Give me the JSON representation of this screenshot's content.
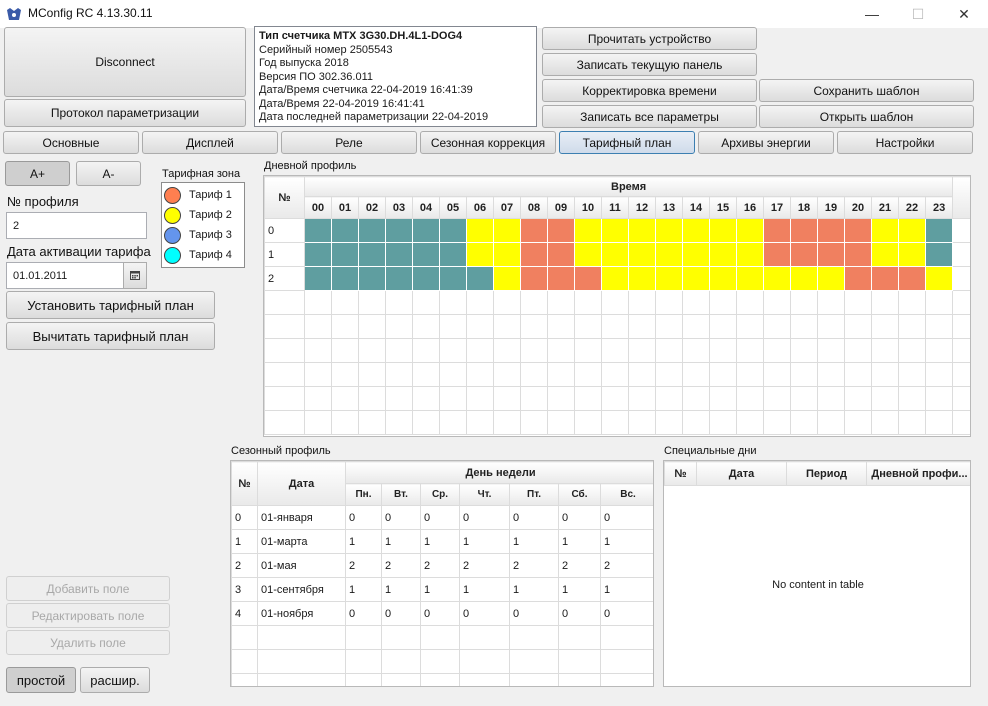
{
  "window": {
    "title": "MConfig RC 4.13.30.11",
    "min_glyph": "—",
    "max_glyph": "☐",
    "close_glyph": "✕"
  },
  "top": {
    "disconnect_label": "Disconnect",
    "protocol_label": "Протокол параметризации",
    "info_lines": [
      "Тип счетчика МТХ 3G30.DH.4L1-DOG4",
      "Серийный номер  2505543",
      "Год выпуска 2018",
      "Версия ПО 302.36.011",
      "Дата/Время счетчика  22-04-2019 16:41:39",
      "Дата/Время 22-04-2019 16:41:41",
      "Дата последней параметризации  22-04-2019"
    ],
    "read_device": "Прочитать устройство",
    "write_panel": "Записать текущую панель",
    "time_correction": "Корректировка времени",
    "write_all": "Записать все параметры",
    "save_template": "Сохранить шаблон",
    "open_template": "Открыть шаблон"
  },
  "tabs": [
    "Основные",
    "Дисплей",
    "Реле",
    "Сезонная коррекция",
    "Тарифный план",
    "Архивы энергии",
    "Настройки"
  ],
  "active_tab": 4,
  "left": {
    "font_plus": "A+",
    "font_minus": "A-",
    "profile_no_label": "№ профиля",
    "profile_no_value": "2",
    "activation_label": "Дата активации тарифа",
    "activation_value": "01.01.2011",
    "set_plan": "Установить тарифный план",
    "read_plan": "Вычитать тарифный план",
    "add_field": "Добавить поле",
    "edit_field": "Редактировать поле",
    "delete_field": "Удалить поле",
    "mode_simple": "простой",
    "mode_extended": "расшир."
  },
  "tariff_zone": {
    "title": "Тарифная зона",
    "items": [
      {
        "label": "Тариф 1",
        "color": "#ff7f50"
      },
      {
        "label": "Тариф 2",
        "color": "#ffff00"
      },
      {
        "label": "Тариф 3",
        "color": "#6495ed"
      },
      {
        "label": "Тариф 4",
        "color": "#00ffff"
      }
    ]
  },
  "daily_profile": {
    "title": "Дневной профиль",
    "num_header": "№",
    "time_header": "Время",
    "hours": [
      "00",
      "01",
      "02",
      "03",
      "04",
      "05",
      "06",
      "07",
      "08",
      "09",
      "10",
      "11",
      "12",
      "13",
      "14",
      "15",
      "16",
      "17",
      "18",
      "19",
      "20",
      "21",
      "22",
      "23"
    ],
    "cell_colors": {
      "1": "#f08060",
      "2": "#ffff00",
      "3": "#5f9ea0"
    },
    "rows": [
      {
        "num": "0",
        "tariffs": [
          3,
          3,
          3,
          3,
          3,
          3,
          2,
          2,
          1,
          1,
          2,
          2,
          2,
          2,
          2,
          2,
          2,
          1,
          1,
          1,
          1,
          2,
          2,
          3
        ]
      },
      {
        "num": "1",
        "tariffs": [
          3,
          3,
          3,
          3,
          3,
          3,
          2,
          2,
          1,
          1,
          2,
          2,
          2,
          2,
          2,
          2,
          2,
          1,
          1,
          1,
          1,
          2,
          2,
          3
        ]
      },
      {
        "num": "2",
        "tariffs": [
          3,
          3,
          3,
          3,
          3,
          3,
          3,
          2,
          1,
          1,
          1,
          2,
          2,
          2,
          2,
          2,
          2,
          2,
          2,
          2,
          1,
          1,
          1,
          2
        ]
      }
    ]
  },
  "seasonal_profile": {
    "title": "Сезонный профиль",
    "num_header": "№",
    "date_header": "Дата",
    "weekday_header": "День недели",
    "days": [
      "Пн.",
      "Вт.",
      "Ср.",
      "Чт.",
      "Пт.",
      "Сб.",
      "Вс."
    ],
    "rows": [
      {
        "num": "0",
        "date": "01-января",
        "values": [
          "0",
          "0",
          "0",
          "0",
          "0",
          "0",
          "0"
        ]
      },
      {
        "num": "1",
        "date": "01-марта",
        "values": [
          "1",
          "1",
          "1",
          "1",
          "1",
          "1",
          "1"
        ]
      },
      {
        "num": "2",
        "date": "01-мая",
        "values": [
          "2",
          "2",
          "2",
          "2",
          "2",
          "2",
          "2"
        ]
      },
      {
        "num": "3",
        "date": "01-сентября",
        "values": [
          "1",
          "1",
          "1",
          "1",
          "1",
          "1",
          "1"
        ]
      },
      {
        "num": "4",
        "date": "01-ноября",
        "values": [
          "0",
          "0",
          "0",
          "0",
          "0",
          "0",
          "0"
        ]
      }
    ]
  },
  "special_days": {
    "title": "Специальные дни",
    "columns": [
      "№",
      "Дата",
      "Период",
      "Дневной профи..."
    ],
    "empty_text": "No content in table"
  }
}
